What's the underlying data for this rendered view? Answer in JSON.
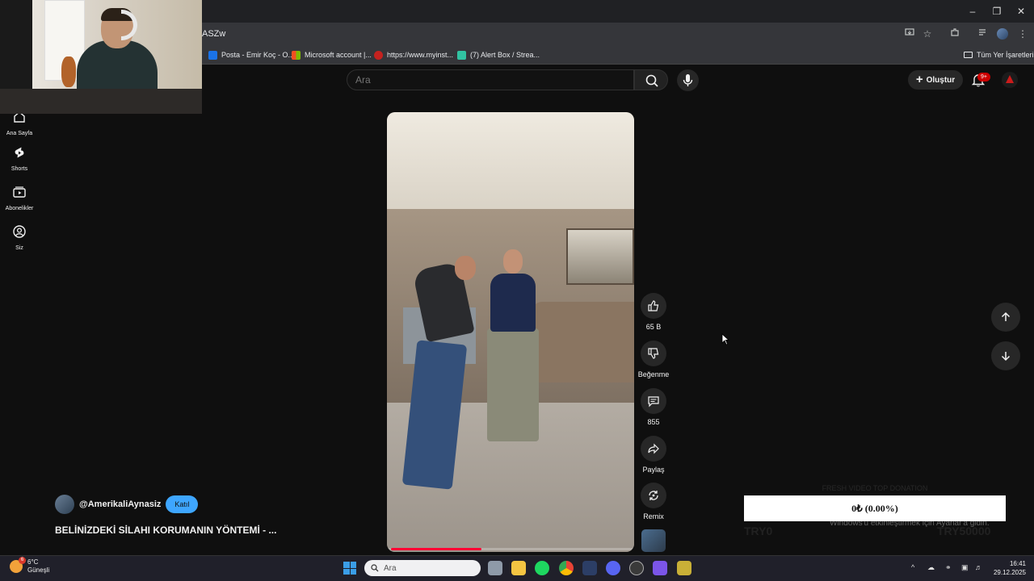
{
  "browser": {
    "url_fragment": "ASZw",
    "bookmarks": [
      {
        "label": "Posta - Emir Koç - O...",
        "color": "#1a73e8"
      },
      {
        "label": "Microsoft account |...",
        "color": "#f25022"
      },
      {
        "label": "https://www.myinst...",
        "color": "#c5221f"
      },
      {
        "label": "(7) Alert Box / Strea...",
        "color": "#31c3a2"
      }
    ],
    "bookmarks_folder": "Tüm Yer İşaretleri"
  },
  "youtube": {
    "search_placeholder": "Ara",
    "create_label": "Oluştur",
    "notif_count": "9+",
    "sidebar": [
      {
        "label": "Ana Sayfa",
        "icon": "home-icon"
      },
      {
        "label": "Shorts",
        "icon": "shorts-icon"
      },
      {
        "label": "Abonelikler",
        "icon": "subscriptions-icon"
      },
      {
        "label": "Siz",
        "icon": "you-icon"
      }
    ],
    "short": {
      "channel": "@AmerikaliAynasiz",
      "join_label": "Katıl",
      "title": "BELİNİZDEKİ SİLAHI KORUMANIN YÖNTEMİ - ...",
      "progress": 0.38
    },
    "actions": {
      "like_count": "65 B",
      "dislike_label": "Beğenme",
      "comment_count": "855",
      "share_label": "Paylaş",
      "remix_label": "Remix"
    }
  },
  "overlay": {
    "donation_text": "0₺ (0.00%)",
    "ghost_title": "FRESH VIDEO TOP DONATION",
    "activate_windows": "Windows'u etkinleştirmek için Ayarlar'a gidin.",
    "goal_left": "TRY0",
    "goal_right": "TRY50000"
  },
  "taskbar": {
    "weather_temp": "6°C",
    "weather_desc": "Güneşli",
    "weather_badge": "6",
    "search_placeholder": "Ara",
    "time": "16:41",
    "date": "29.12.2025"
  }
}
